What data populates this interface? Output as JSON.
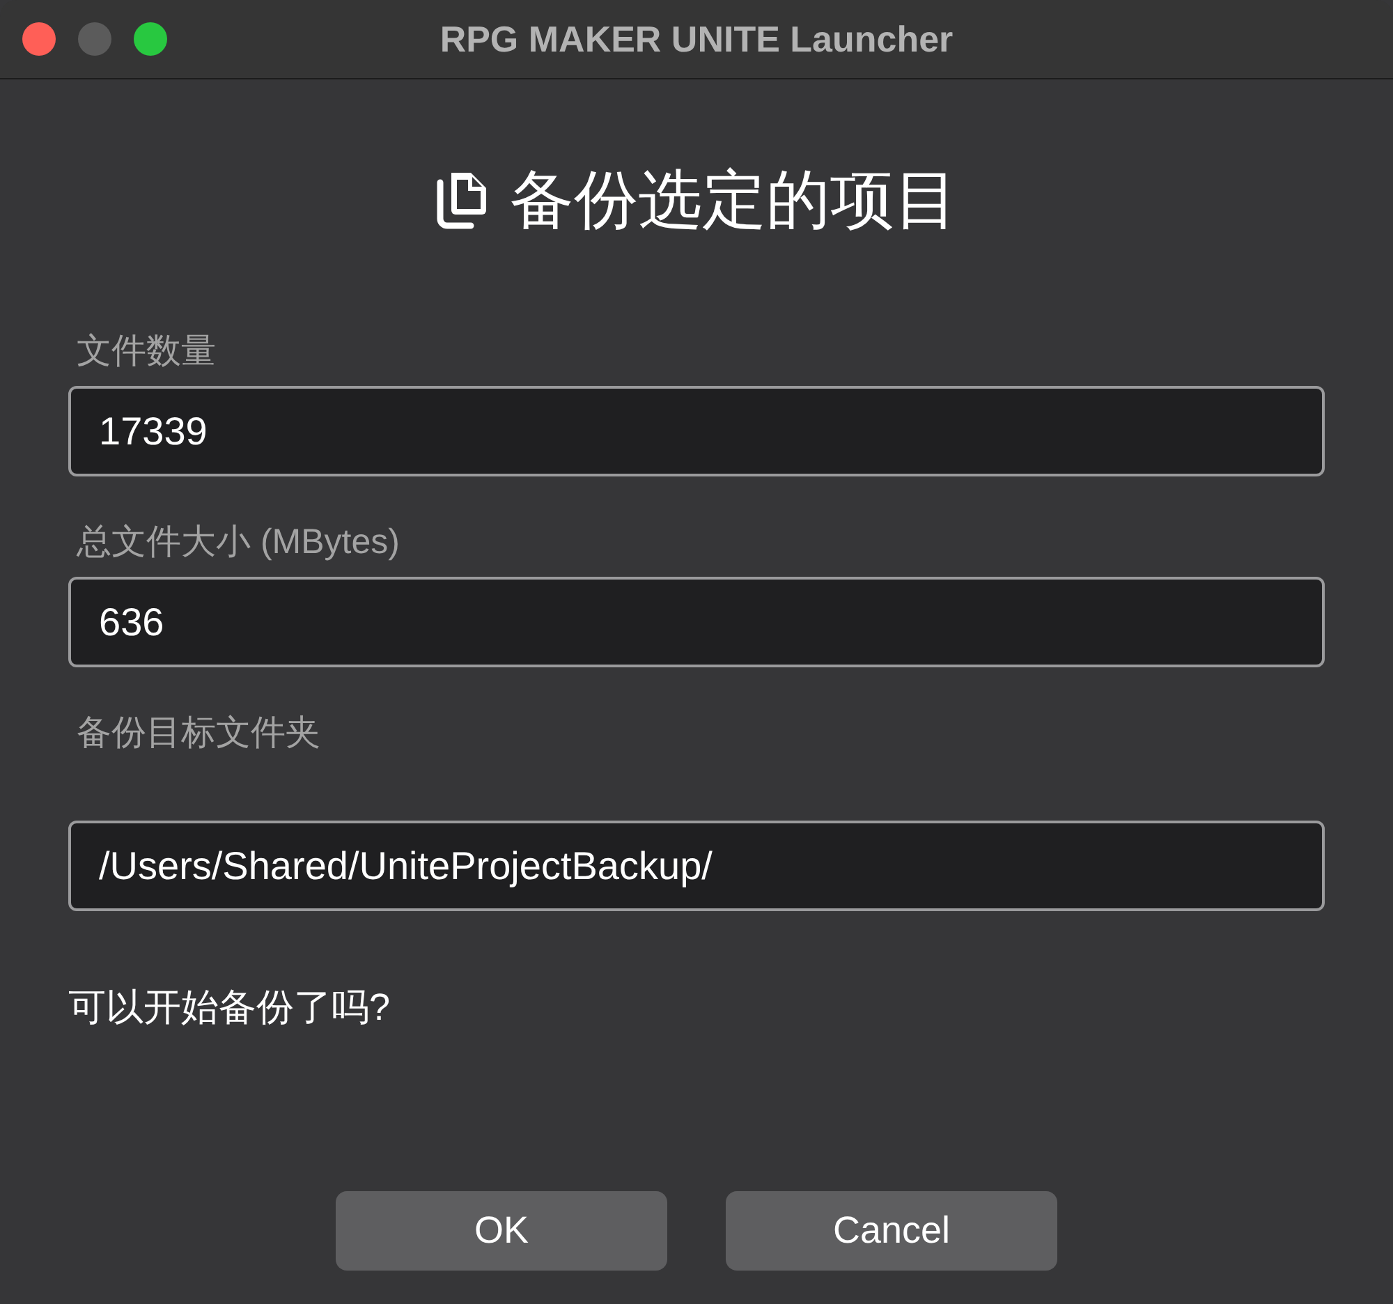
{
  "window": {
    "title": "RPG MAKER UNITE Launcher",
    "controls": [
      {
        "kind": "close",
        "disabled": false
      },
      {
        "kind": "minimize",
        "disabled": true
      },
      {
        "kind": "zoom",
        "disabled": false
      }
    ]
  },
  "dialog": {
    "title": "备份选定的项目",
    "fields": [
      {
        "label": "文件数量",
        "value": "17339"
      },
      {
        "label": "总文件大小 (MBytes)",
        "value": "636"
      },
      {
        "label": "备份目标文件夹",
        "value": "/Users/Shared/UniteProjectBackup/"
      }
    ],
    "question": "可以开始备份了吗?",
    "buttons": [
      "OK",
      "Cancel"
    ]
  }
}
